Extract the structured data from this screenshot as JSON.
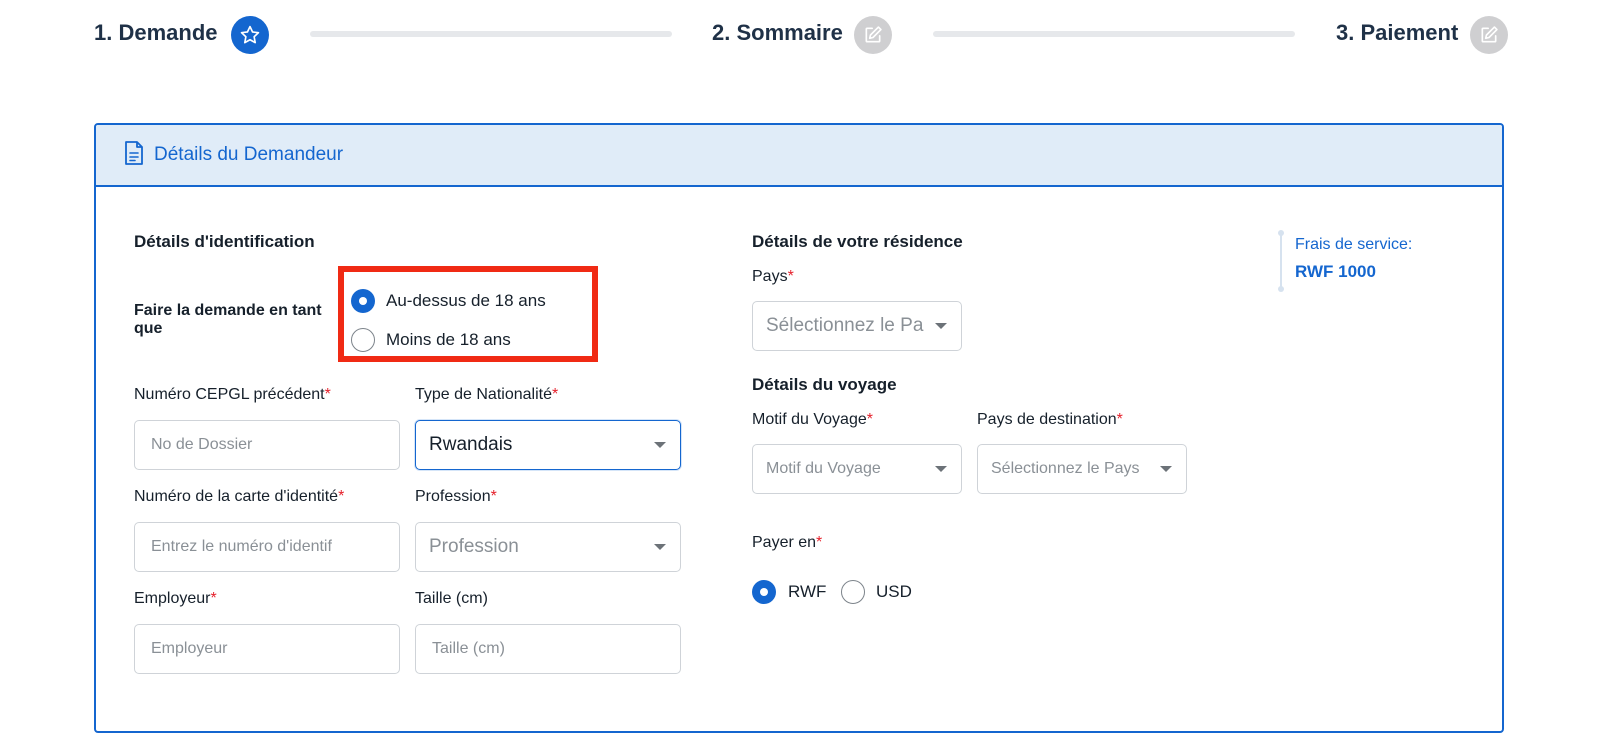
{
  "stepper": {
    "steps": [
      {
        "label": "1. Demande",
        "icon": "star-icon",
        "state": "active"
      },
      {
        "label": "2. Sommaire",
        "icon": "edit-icon",
        "state": "inactive"
      },
      {
        "label": "3. Paiement",
        "icon": "edit-icon",
        "state": "inactive"
      }
    ]
  },
  "card": {
    "title": "Détails du Demandeur",
    "icon": "document-icon"
  },
  "identification": {
    "title": "Détails d'identification",
    "apply_as": {
      "label": "Faire la demande en tant que",
      "options": [
        "Au-dessus de 18 ans",
        "Moins de 18 ans"
      ],
      "selected": "Au-dessus de 18 ans"
    },
    "cepgl": {
      "label": "Numéro CEPGL précédent",
      "placeholder": "No de Dossier",
      "required": true
    },
    "nationality": {
      "label": "Type de Nationalité",
      "value": "Rwandais",
      "required": true
    },
    "id_card": {
      "label": "Numéro de la carte d'identité",
      "placeholder": "Entrez le numéro d'identif",
      "required": true
    },
    "profession": {
      "label": "Profession",
      "placeholder": "Profession",
      "required": true
    },
    "employer": {
      "label": "Employeur",
      "placeholder": "Employeur",
      "required": true
    },
    "height": {
      "label": "Taille (cm)",
      "placeholder": "Taille (cm)",
      "required": false
    }
  },
  "residence": {
    "title": "Détails de votre résidence",
    "country": {
      "label": "Pays",
      "placeholder": "Sélectionnez le Pa",
      "required": true
    }
  },
  "travel": {
    "title": "Détails du voyage",
    "reason": {
      "label": "Motif du Voyage",
      "placeholder": "Motif du Voyage",
      "required": true
    },
    "destination": {
      "label": "Pays de destination",
      "placeholder": "Sélectionnez le Pays",
      "required": true
    }
  },
  "payment": {
    "label": "Payer en",
    "required_mark": "*",
    "options": [
      "RWF",
      "USD"
    ],
    "selected": "RWF"
  },
  "fee": {
    "label": "Frais de service:",
    "amount": "RWF 1000"
  },
  "required_mark": "*",
  "colors": {
    "accent": "#1466cf",
    "header_bg": "#e0ecf8",
    "required": "#e5202b",
    "highlight": "#f02a14"
  }
}
